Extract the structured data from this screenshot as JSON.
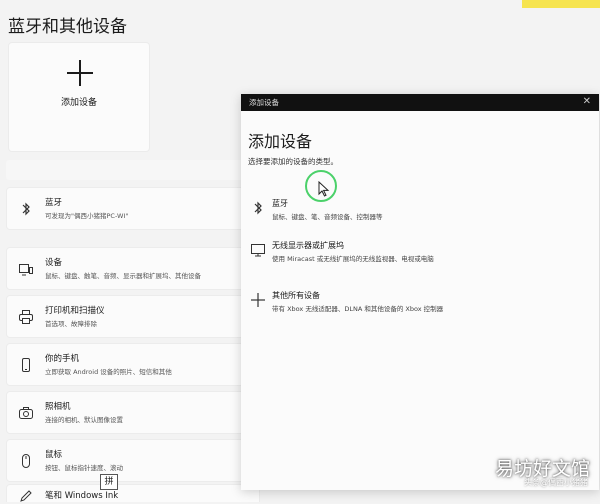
{
  "page": {
    "title": "蓝牙和其他设备"
  },
  "add_card": {
    "label": "添加设备"
  },
  "rows": [
    {
      "title": "蓝牙",
      "subtitle": "可发现为\"偶西小猪猪PC-WI\"",
      "icon": "bluetooth-icon"
    },
    {
      "title": "设备",
      "subtitle": "鼠标、键盘、触笔、音频、显示器和扩展坞、其他设备",
      "icon": "devices-icon"
    },
    {
      "title": "打印机和扫描仪",
      "subtitle": "首选项、故障排除",
      "icon": "printer-icon"
    },
    {
      "title": "你的手机",
      "subtitle": "立即获取 Android 设备的照片、短信和其他",
      "icon": "phone-icon"
    },
    {
      "title": "照相机",
      "subtitle": "连接的相机、默认图像设置",
      "icon": "camera-icon"
    },
    {
      "title": "鼠标",
      "subtitle": "按钮、鼠标指针速度、滚动",
      "icon": "mouse-icon"
    },
    {
      "title": "笔和 Windows Ink",
      "subtitle": "",
      "icon": "pen-icon"
    }
  ],
  "dialog": {
    "caption": "添加设备",
    "close": "✕",
    "title": "添加设备",
    "subtitle": "选择要添加的设备的类型。",
    "options": [
      {
        "title": "蓝牙",
        "subtitle": "鼠标、键盘、笔、音频设备、控制器等",
        "icon": "bluetooth-icon"
      },
      {
        "title": "无线显示器或扩展坞",
        "subtitle": "使用 Miracast 或无线扩展坞的无线监视器、电视或电脑",
        "icon": "monitor-icon"
      },
      {
        "title": "其他所有设备",
        "subtitle": "带有 Xbox 无线适配器、DLNA 和其他设备的 Xbox 控制器",
        "icon": "plus-icon"
      }
    ]
  },
  "watermark": {
    "main": "易坊好文馆",
    "sub": "头条@偶西小猪猪"
  },
  "ime_badge": "拼",
  "colors": {
    "accent_ring": "#4bd16a",
    "title_bar": "#111111",
    "highlight": "#f6e44f"
  }
}
